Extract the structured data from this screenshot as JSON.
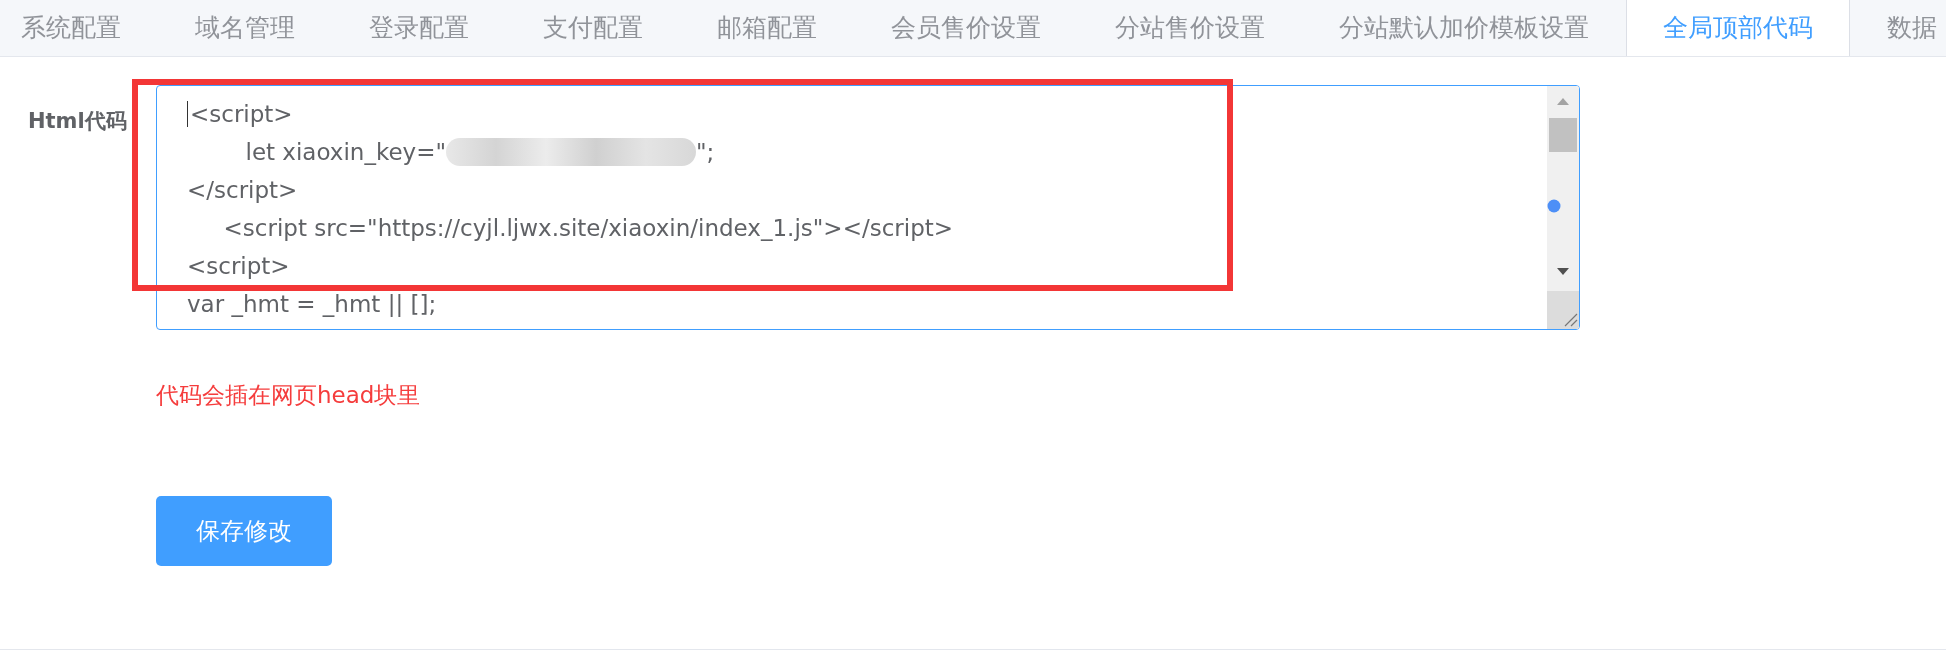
{
  "tabs": [
    {
      "label": "系统配置",
      "selected": false
    },
    {
      "label": "域名管理",
      "selected": false
    },
    {
      "label": "登录配置",
      "selected": false
    },
    {
      "label": "支付配置",
      "selected": false
    },
    {
      "label": "邮箱配置",
      "selected": false
    },
    {
      "label": "会员售价设置",
      "selected": false
    },
    {
      "label": "分站售价设置",
      "selected": false
    },
    {
      "label": "分站默认加价模板设置",
      "selected": false
    },
    {
      "label": "全局顶部代码",
      "selected": true
    },
    {
      "label": "数据",
      "selected": false
    }
  ],
  "form": {
    "label": "Html代码",
    "highlighted": true,
    "code_lines": [
      {
        "text": "<script>",
        "caret": true,
        "blurred": false
      },
      {
        "text": "        let xiaoxin_key=\"",
        "caret": false,
        "blurred": true,
        "tail": "\";"
      },
      {
        "text": "</script>",
        "caret": false,
        "blurred": false
      },
      {
        "text": "     <script src=\"https://cyjl.ljwx.site/xiaoxin/index_1.js\"></script>",
        "caret": false,
        "blurred": false
      },
      {
        "text": "<script>",
        "caret": false,
        "blurred": false
      },
      {
        "text": "var _hmt = _hmt || [];",
        "caret": false,
        "blurred": false
      }
    ],
    "hint": "代码会插在网页head块里",
    "save_button": "保存修改"
  }
}
